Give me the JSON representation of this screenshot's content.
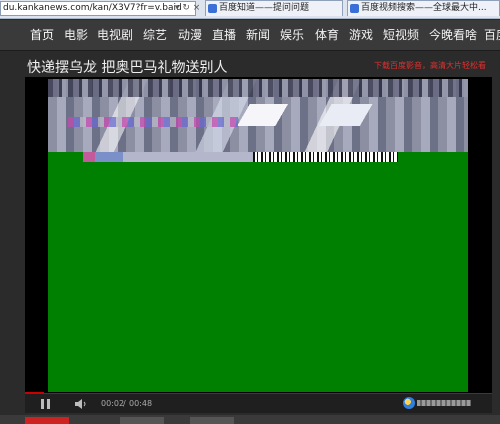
{
  "browser": {
    "url": "du.kankanews.com/kan/X3V7?fr=v.baid",
    "addr_controls": "▾ ↻ ×",
    "tabs": [
      {
        "label": "百度知道——提问问题"
      },
      {
        "label": "百度视频搜索——全球最大中..."
      }
    ]
  },
  "nav": {
    "items": [
      "首页",
      "电影",
      "电视剧",
      "综艺",
      "动漫",
      "直播",
      "新闻",
      "娱乐",
      "体育",
      "游戏",
      "短视频",
      "今晚看啥",
      "百度"
    ]
  },
  "video": {
    "title": "快递摆乌龙 把奥巴马礼物送别人",
    "note": "下载百度影音，高清大片轻松看"
  },
  "player": {
    "current_time": "00:02",
    "separator": "/",
    "total_time": "00:48",
    "progress": 0.04
  },
  "colors": {
    "accent": "#cc0000",
    "video_background": "#008000"
  }
}
